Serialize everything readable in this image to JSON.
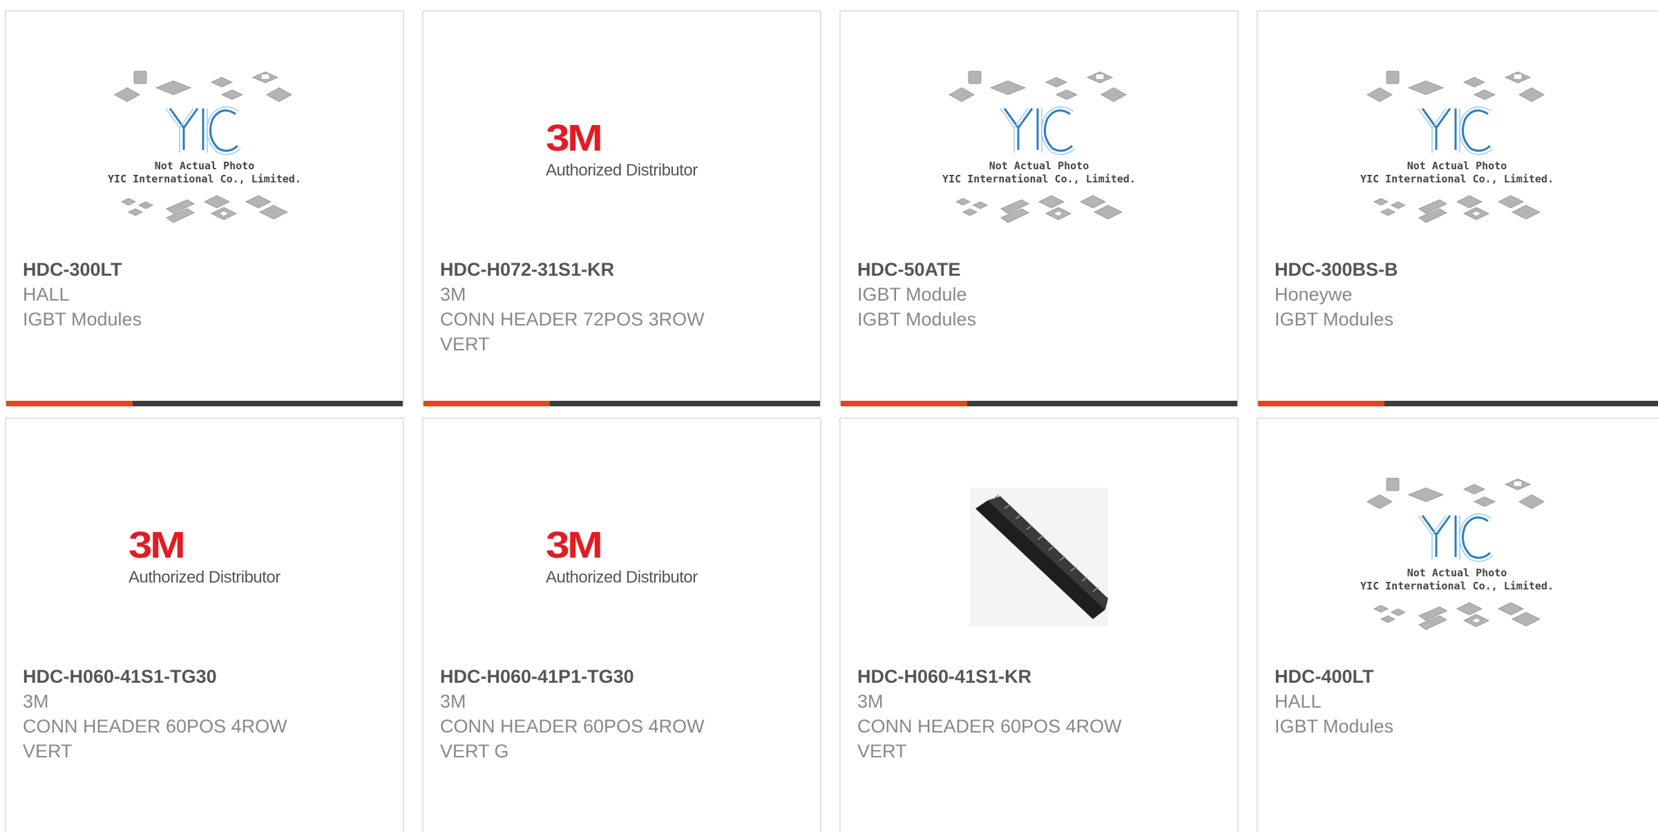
{
  "products": [
    {
      "part": "HDC-300LT",
      "manufacturer": "HALL",
      "description": "IGBT Modules",
      "image": "yic-placeholder"
    },
    {
      "part": "HDC-H072-31S1-KR",
      "manufacturer": "3M",
      "description": "CONN HEADER 72POS 3ROW VERT",
      "image": "3m-logo"
    },
    {
      "part": "HDC-50ATE",
      "manufacturer": "IGBT Module",
      "description": "IGBT Modules",
      "image": "yic-placeholder"
    },
    {
      "part": "HDC-300BS-B",
      "manufacturer": "Honeywe",
      "description": "IGBT Modules",
      "image": "yic-placeholder"
    },
    {
      "part": "HDC-H060-41S1-TG30",
      "manufacturer": "3M",
      "description": "CONN HEADER 60POS 4ROW VERT",
      "image": "3m-logo"
    },
    {
      "part": "HDC-H060-41P1-TG30",
      "manufacturer": "3M",
      "description": "CONN HEADER 60POS 4ROW VERT G",
      "image": "3m-logo"
    },
    {
      "part": "HDC-H060-41S1-KR",
      "manufacturer": "3M",
      "description": "CONN HEADER 60POS 4ROW VERT",
      "image": "connector-photo"
    },
    {
      "part": "HDC-400LT",
      "manufacturer": "HALL",
      "description": "IGBT Modules",
      "image": "yic-placeholder"
    }
  ],
  "yic_placeholder": {
    "line1": "Not Actual Photo",
    "line2": "YIC International Co., Limited.",
    "brand": "YIC"
  },
  "logo_3m": {
    "mark": "3M",
    "tagline": "Authorized Distributor"
  },
  "colors": {
    "accent": "#e8431a",
    "bar": "#3c3c3c",
    "brand_3m": "#e31b23",
    "yic_blue": "#2a7fc0"
  }
}
